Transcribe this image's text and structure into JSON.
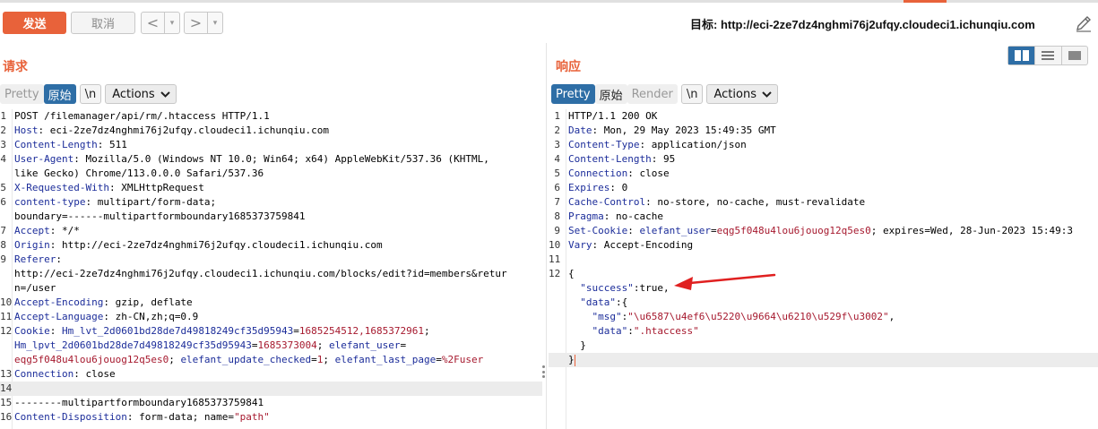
{
  "toolbar": {
    "send_label": "发送",
    "cancel_label": "取消",
    "back_glyph": "<",
    "forward_glyph": ">",
    "dropdown_glyph": "▾",
    "target_label": "目标: http://eci-2ze7dz4nghmi76j2ufqy.cloudeci1.ichunqiu.com",
    "edit_icon": "pencil-icon"
  },
  "request": {
    "title": "请求",
    "tabs": {
      "pretty": "Pretty",
      "raw": "原始",
      "newline": "\\n"
    },
    "actions_label": "Actions",
    "lines": [
      {
        "n": "1",
        "parts": [
          [
            "t",
            "POST /filemanager/api/rm/.htaccess HTTP/1.1"
          ]
        ]
      },
      {
        "n": "2",
        "parts": [
          [
            "h",
            "Host"
          ],
          [
            "t",
            ": eci-2ze7dz4nghmi76j2ufqy.cloudeci1.ichunqiu.com"
          ]
        ]
      },
      {
        "n": "3",
        "parts": [
          [
            "h",
            "Content-Length"
          ],
          [
            "t",
            ": 511"
          ]
        ]
      },
      {
        "n": "4",
        "parts": [
          [
            "h",
            "User-Agent"
          ],
          [
            "t",
            ": Mozilla/5.0 (Windows NT 10.0; Win64; x64) AppleWebKit/537.36 (KHTML,"
          ]
        ]
      },
      {
        "n": "",
        "parts": [
          [
            "t",
            "like Gecko) Chrome/113.0.0.0 Safari/537.36"
          ]
        ]
      },
      {
        "n": "5",
        "parts": [
          [
            "h",
            "X-Requested-With"
          ],
          [
            "t",
            ": XMLHttpRequest"
          ]
        ]
      },
      {
        "n": "6",
        "parts": [
          [
            "h",
            "content-type"
          ],
          [
            "t",
            ": multipart/form-data;"
          ]
        ]
      },
      {
        "n": "",
        "parts": [
          [
            "t",
            "boundary=------multipartformboundary1685373759841"
          ]
        ]
      },
      {
        "n": "7",
        "parts": [
          [
            "h",
            "Accept"
          ],
          [
            "t",
            ": */*"
          ]
        ]
      },
      {
        "n": "8",
        "parts": [
          [
            "h",
            "Origin"
          ],
          [
            "t",
            ": http://eci-2ze7dz4nghmi76j2ufqy.cloudeci1.ichunqiu.com"
          ]
        ]
      },
      {
        "n": "9",
        "parts": [
          [
            "h",
            "Referer"
          ],
          [
            "t",
            ":"
          ]
        ]
      },
      {
        "n": "",
        "parts": [
          [
            "t",
            "http://eci-2ze7dz4nghmi76j2ufqy.cloudeci1.ichunqiu.com/blocks/edit?id=members&retur"
          ]
        ]
      },
      {
        "n": "",
        "parts": [
          [
            "t",
            "n=/user"
          ]
        ]
      },
      {
        "n": "10",
        "parts": [
          [
            "h",
            "Accept-Encoding"
          ],
          [
            "t",
            ": gzip, deflate"
          ]
        ]
      },
      {
        "n": "11",
        "parts": [
          [
            "h",
            "Accept-Language"
          ],
          [
            "t",
            ": zh-CN,zh;q=0.9"
          ]
        ]
      },
      {
        "n": "12",
        "parts": [
          [
            "h",
            "Cookie"
          ],
          [
            "t",
            ": "
          ],
          [
            "h",
            "Hm_lvt_2d0601bd28de7d49818249cf35d95943"
          ],
          [
            "t",
            "="
          ],
          [
            "c",
            "1685254512,1685372961"
          ],
          [
            "t",
            ";"
          ]
        ]
      },
      {
        "n": "",
        "parts": [
          [
            "h",
            "Hm_lpvt_2d0601bd28de7d49818249cf35d95943"
          ],
          [
            "t",
            "="
          ],
          [
            "c",
            "1685373004"
          ],
          [
            "t",
            "; "
          ],
          [
            "h",
            "elefant_user"
          ],
          [
            "t",
            "="
          ]
        ]
      },
      {
        "n": "",
        "parts": [
          [
            "c",
            "eqg5f048u4lou6jouog12q5es0"
          ],
          [
            "t",
            "; "
          ],
          [
            "h",
            "elefant_update_checked"
          ],
          [
            "t",
            "="
          ],
          [
            "c",
            "1"
          ],
          [
            "t",
            "; "
          ],
          [
            "h",
            "elefant_last_page"
          ],
          [
            "t",
            "="
          ],
          [
            "c",
            "%2Fuser"
          ]
        ]
      },
      {
        "n": "13",
        "parts": [
          [
            "h",
            "Connection"
          ],
          [
            "t",
            ": close"
          ]
        ]
      },
      {
        "n": "14",
        "parts": [
          [
            "t",
            ""
          ]
        ],
        "hl": true
      },
      {
        "n": "15",
        "parts": [
          [
            "t",
            "--------multipartformboundary1685373759841"
          ]
        ]
      },
      {
        "n": "16",
        "parts": [
          [
            "h",
            "Content-Disposition"
          ],
          [
            "t",
            ": form-data; name="
          ],
          [
            "c",
            "\"path\""
          ]
        ]
      }
    ]
  },
  "response": {
    "title": "响应",
    "tabs": {
      "pretty": "Pretty",
      "raw": "原始",
      "render": "Render",
      "newline": "\\n"
    },
    "actions_label": "Actions",
    "lines": [
      {
        "n": "1",
        "parts": [
          [
            "t",
            "HTTP/1.1 200 OK"
          ]
        ]
      },
      {
        "n": "2",
        "parts": [
          [
            "h",
            "Date"
          ],
          [
            "t",
            ": Mon, 29 May 2023 15:49:35 GMT"
          ]
        ]
      },
      {
        "n": "3",
        "parts": [
          [
            "h",
            "Content-Type"
          ],
          [
            "t",
            ": application/json"
          ]
        ]
      },
      {
        "n": "4",
        "parts": [
          [
            "h",
            "Content-Length"
          ],
          [
            "t",
            ": 95"
          ]
        ]
      },
      {
        "n": "5",
        "parts": [
          [
            "h",
            "Connection"
          ],
          [
            "t",
            ": close"
          ]
        ]
      },
      {
        "n": "6",
        "parts": [
          [
            "h",
            "Expires"
          ],
          [
            "t",
            ": 0"
          ]
        ]
      },
      {
        "n": "7",
        "parts": [
          [
            "h",
            "Cache-Control"
          ],
          [
            "t",
            ": no-store, no-cache, must-revalidate"
          ]
        ]
      },
      {
        "n": "8",
        "parts": [
          [
            "h",
            "Pragma"
          ],
          [
            "t",
            ": no-cache"
          ]
        ]
      },
      {
        "n": "9",
        "parts": [
          [
            "h",
            "Set-Cookie"
          ],
          [
            "t",
            ": "
          ],
          [
            "h",
            "elefant_user"
          ],
          [
            "t",
            "="
          ],
          [
            "c",
            "eqg5f048u4lou6jouog12q5es0"
          ],
          [
            "t",
            "; expires=Wed, 28-Jun-2023 15:49:3"
          ]
        ]
      },
      {
        "n": "10",
        "parts": [
          [
            "h",
            "Vary"
          ],
          [
            "t",
            ": Accept-Encoding"
          ]
        ]
      },
      {
        "n": "11",
        "parts": [
          [
            "t",
            ""
          ]
        ]
      },
      {
        "n": "12",
        "parts": [
          [
            "t",
            "{"
          ]
        ]
      },
      {
        "n": "",
        "parts": [
          [
            "t",
            "  "
          ],
          [
            "s",
            "\"success\""
          ],
          [
            "t",
            ":true,"
          ]
        ]
      },
      {
        "n": "",
        "parts": [
          [
            "t",
            "  "
          ],
          [
            "s",
            "\"data\""
          ],
          [
            "t",
            ":{"
          ]
        ]
      },
      {
        "n": "",
        "parts": [
          [
            "t",
            "    "
          ],
          [
            "s",
            "\"msg\""
          ],
          [
            "t",
            ":"
          ],
          [
            "c",
            "\"\\u6587\\u4ef6\\u5220\\u9664\\u6210\\u529f\\u3002\""
          ],
          [
            "t",
            ","
          ]
        ]
      },
      {
        "n": "",
        "parts": [
          [
            "t",
            "    "
          ],
          [
            "s",
            "\"data\""
          ],
          [
            "t",
            ":"
          ],
          [
            "c",
            "\".htaccess\""
          ]
        ]
      },
      {
        "n": "",
        "parts": [
          [
            "t",
            "  }"
          ]
        ]
      },
      {
        "n": "",
        "parts": [
          [
            "t",
            "}"
          ]
        ],
        "hl": true,
        "caret": true
      }
    ]
  },
  "layout_toggle": {
    "options": [
      "split-columns-icon",
      "split-rows-icon",
      "single-pane-icon"
    ],
    "active": 0
  },
  "colors": {
    "accent": "#e8623a",
    "active_tab": "#2e6ea6",
    "header_name": "#1c2d9a",
    "cookie_value": "#a6192e",
    "arrow": "#e02020"
  }
}
